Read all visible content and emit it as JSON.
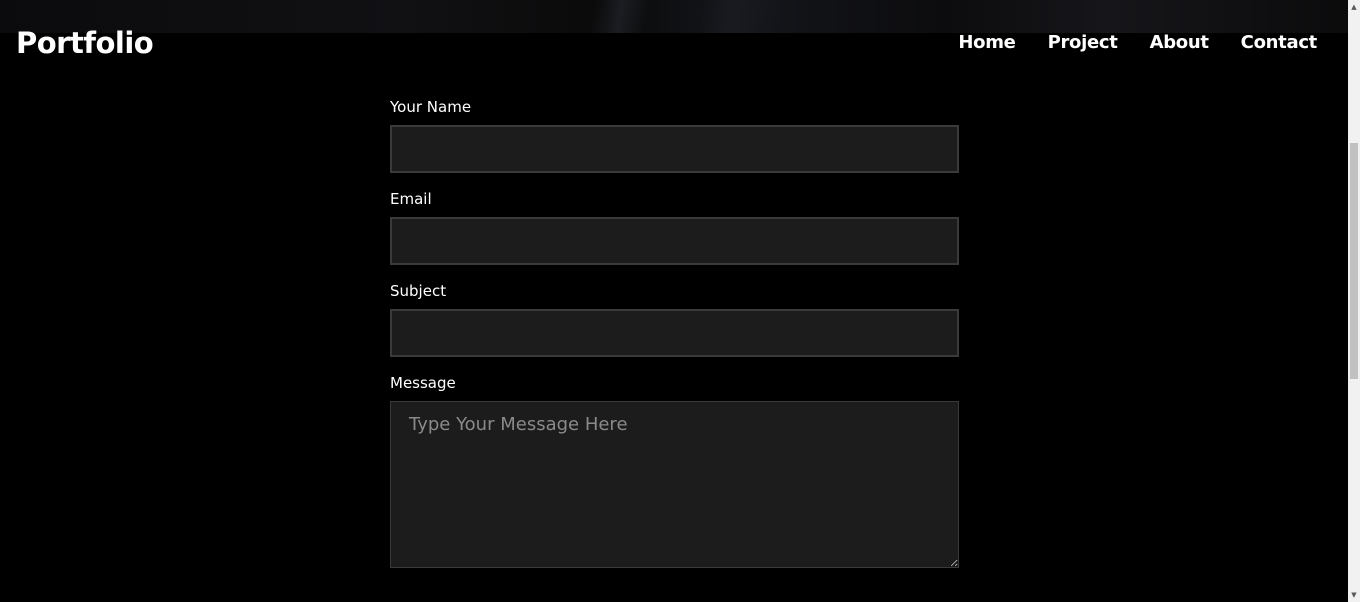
{
  "header": {
    "logo": "Portfolio",
    "nav": [
      "Home",
      "Project",
      "About",
      "Contact"
    ]
  },
  "form": {
    "name_label": "Your Name",
    "name_value": "",
    "email_label": "Email",
    "email_value": "",
    "subject_label": "Subject",
    "subject_value": "",
    "message_label": "Message",
    "message_placeholder": "Type Your Message Here",
    "message_value": ""
  },
  "scrollbar": {
    "up_icon": "chevron-up-icon",
    "down_icon": "chevron-down-icon"
  },
  "colors": {
    "background": "#000000",
    "input_bg": "#1c1c1c",
    "input_border": "#3a3a3a",
    "text": "#ffffff",
    "placeholder": "#8a8a8a"
  }
}
